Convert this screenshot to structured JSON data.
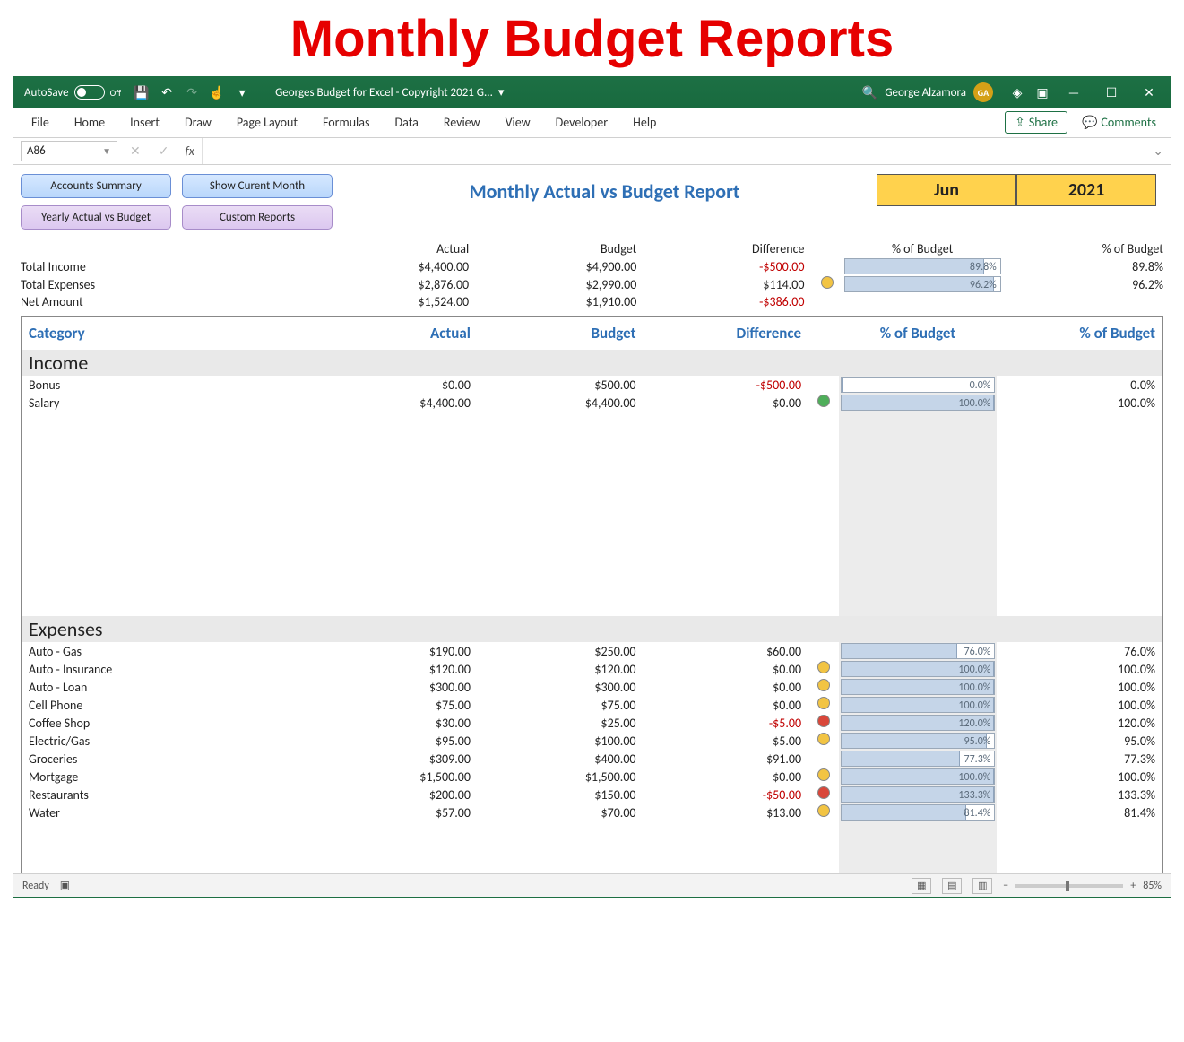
{
  "page_heading": "Monthly Budget Reports",
  "titlebar": {
    "autosave_label": "AutoSave",
    "autosave_state": "Off",
    "document_name": "Georges Budget for Excel - Copyright 2021 G...",
    "user_name": "George Alzamora",
    "user_initials": "GA"
  },
  "ribbon": {
    "tabs": [
      "File",
      "Home",
      "Insert",
      "Draw",
      "Page Layout",
      "Formulas",
      "Data",
      "Review",
      "View",
      "Developer",
      "Help"
    ],
    "share_label": "Share",
    "comments_label": "Comments"
  },
  "namebox": "A86",
  "fx_label": "fx",
  "buttons": {
    "accounts_summary": "Accounts Summary",
    "show_current_month": "Show Curent Month",
    "yearly_actual_vs_budget": "Yearly Actual vs Budget",
    "custom_reports": "Custom Reports"
  },
  "report_title": "Monthly Actual vs Budget Report",
  "period": {
    "month": "Jun",
    "year": "2021"
  },
  "columns": {
    "actual": "Actual",
    "budget": "Budget",
    "difference": "Difference",
    "pct1": "% of Budget",
    "pct2": "% of Budget",
    "category": "Category"
  },
  "totals": [
    {
      "label": "Total Income",
      "actual": "$4,400.00",
      "budget": "$4,900.00",
      "difference": "-$500.00",
      "dot": "",
      "bar_pct": 89.8,
      "bar_txt": "89.8%",
      "pct": "89.8%"
    },
    {
      "label": "Total Expenses",
      "actual": "$2,876.00",
      "budget": "$2,990.00",
      "difference": "$114.00",
      "dot": "yellow",
      "bar_pct": 96.2,
      "bar_txt": "96.2%",
      "pct": "96.2%"
    },
    {
      "label": "Net Amount",
      "actual": "$1,524.00",
      "budget": "$1,910.00",
      "difference": "-$386.00",
      "dot": "",
      "bar_pct": null,
      "bar_txt": "",
      "pct": ""
    }
  ],
  "sections": {
    "income_label": "Income",
    "expenses_label": "Expenses"
  },
  "income": [
    {
      "label": "Bonus",
      "actual": "$0.00",
      "budget": "$500.00",
      "difference": "-$500.00",
      "dot": "",
      "bar_pct": 0.0,
      "bar_txt": "0.0%",
      "pct": "0.0%"
    },
    {
      "label": "Salary",
      "actual": "$4,400.00",
      "budget": "$4,400.00",
      "difference": "$0.00",
      "dot": "green",
      "bar_pct": 100.0,
      "bar_txt": "100.0%",
      "pct": "100.0%"
    }
  ],
  "expenses": [
    {
      "label": "Auto - Gas",
      "actual": "$190.00",
      "budget": "$250.00",
      "difference": "$60.00",
      "dot": "",
      "bar_pct": 76.0,
      "bar_txt": "76.0%",
      "pct": "76.0%"
    },
    {
      "label": "Auto - Insurance",
      "actual": "$120.00",
      "budget": "$120.00",
      "difference": "$0.00",
      "dot": "yellow",
      "bar_pct": 100.0,
      "bar_txt": "100.0%",
      "pct": "100.0%"
    },
    {
      "label": "Auto - Loan",
      "actual": "$300.00",
      "budget": "$300.00",
      "difference": "$0.00",
      "dot": "yellow",
      "bar_pct": 100.0,
      "bar_txt": "100.0%",
      "pct": "100.0%"
    },
    {
      "label": "Cell Phone",
      "actual": "$75.00",
      "budget": "$75.00",
      "difference": "$0.00",
      "dot": "yellow",
      "bar_pct": 100.0,
      "bar_txt": "100.0%",
      "pct": "100.0%"
    },
    {
      "label": "Coffee Shop",
      "actual": "$30.00",
      "budget": "$25.00",
      "difference": "-$5.00",
      "dot": "red",
      "bar_pct": 100.0,
      "bar_txt": "120.0%",
      "pct": "120.0%"
    },
    {
      "label": "Electric/Gas",
      "actual": "$95.00",
      "budget": "$100.00",
      "difference": "$5.00",
      "dot": "yellow",
      "bar_pct": 95.0,
      "bar_txt": "95.0%",
      "pct": "95.0%"
    },
    {
      "label": "Groceries",
      "actual": "$309.00",
      "budget": "$400.00",
      "difference": "$91.00",
      "dot": "",
      "bar_pct": 77.3,
      "bar_txt": "77.3%",
      "pct": "77.3%"
    },
    {
      "label": "Mortgage",
      "actual": "$1,500.00",
      "budget": "$1,500.00",
      "difference": "$0.00",
      "dot": "yellow",
      "bar_pct": 100.0,
      "bar_txt": "100.0%",
      "pct": "100.0%"
    },
    {
      "label": "Restaurants",
      "actual": "$200.00",
      "budget": "$150.00",
      "difference": "-$50.00",
      "dot": "red",
      "bar_pct": 100.0,
      "bar_txt": "133.3%",
      "pct": "133.3%"
    },
    {
      "label": "Water",
      "actual": "$57.00",
      "budget": "$70.00",
      "difference": "$13.00",
      "dot": "yellow",
      "bar_pct": 81.4,
      "bar_txt": "81.4%",
      "pct": "81.4%"
    }
  ],
  "status": {
    "ready": "Ready",
    "zoom": "85%"
  },
  "chart_data": {
    "type": "table",
    "title": "Monthly Actual vs Budget Report — Jun 2021",
    "columns": [
      "Category",
      "Actual",
      "Budget",
      "Difference",
      "% of Budget"
    ],
    "totals": [
      {
        "category": "Total Income",
        "actual": 4400.0,
        "budget": 4900.0,
        "difference": -500.0,
        "pct_of_budget": 89.8
      },
      {
        "category": "Total Expenses",
        "actual": 2876.0,
        "budget": 2990.0,
        "difference": 114.0,
        "pct_of_budget": 96.2
      },
      {
        "category": "Net Amount",
        "actual": 1524.0,
        "budget": 1910.0,
        "difference": -386.0,
        "pct_of_budget": null
      }
    ],
    "income": [
      {
        "category": "Bonus",
        "actual": 0.0,
        "budget": 500.0,
        "difference": -500.0,
        "pct_of_budget": 0.0
      },
      {
        "category": "Salary",
        "actual": 4400.0,
        "budget": 4400.0,
        "difference": 0.0,
        "pct_of_budget": 100.0
      }
    ],
    "expenses": [
      {
        "category": "Auto - Gas",
        "actual": 190.0,
        "budget": 250.0,
        "difference": 60.0,
        "pct_of_budget": 76.0
      },
      {
        "category": "Auto - Insurance",
        "actual": 120.0,
        "budget": 120.0,
        "difference": 0.0,
        "pct_of_budget": 100.0
      },
      {
        "category": "Auto - Loan",
        "actual": 300.0,
        "budget": 300.0,
        "difference": 0.0,
        "pct_of_budget": 100.0
      },
      {
        "category": "Cell Phone",
        "actual": 75.0,
        "budget": 75.0,
        "difference": 0.0,
        "pct_of_budget": 100.0
      },
      {
        "category": "Coffee Shop",
        "actual": 30.0,
        "budget": 25.0,
        "difference": -5.0,
        "pct_of_budget": 120.0
      },
      {
        "category": "Electric/Gas",
        "actual": 95.0,
        "budget": 100.0,
        "difference": 5.0,
        "pct_of_budget": 95.0
      },
      {
        "category": "Groceries",
        "actual": 309.0,
        "budget": 400.0,
        "difference": 91.0,
        "pct_of_budget": 77.3
      },
      {
        "category": "Mortgage",
        "actual": 1500.0,
        "budget": 1500.0,
        "difference": 0.0,
        "pct_of_budget": 100.0
      },
      {
        "category": "Restaurants",
        "actual": 200.0,
        "budget": 150.0,
        "difference": -50.0,
        "pct_of_budget": 133.3
      },
      {
        "category": "Water",
        "actual": 57.0,
        "budget": 70.0,
        "difference": 13.0,
        "pct_of_budget": 81.4
      }
    ]
  }
}
